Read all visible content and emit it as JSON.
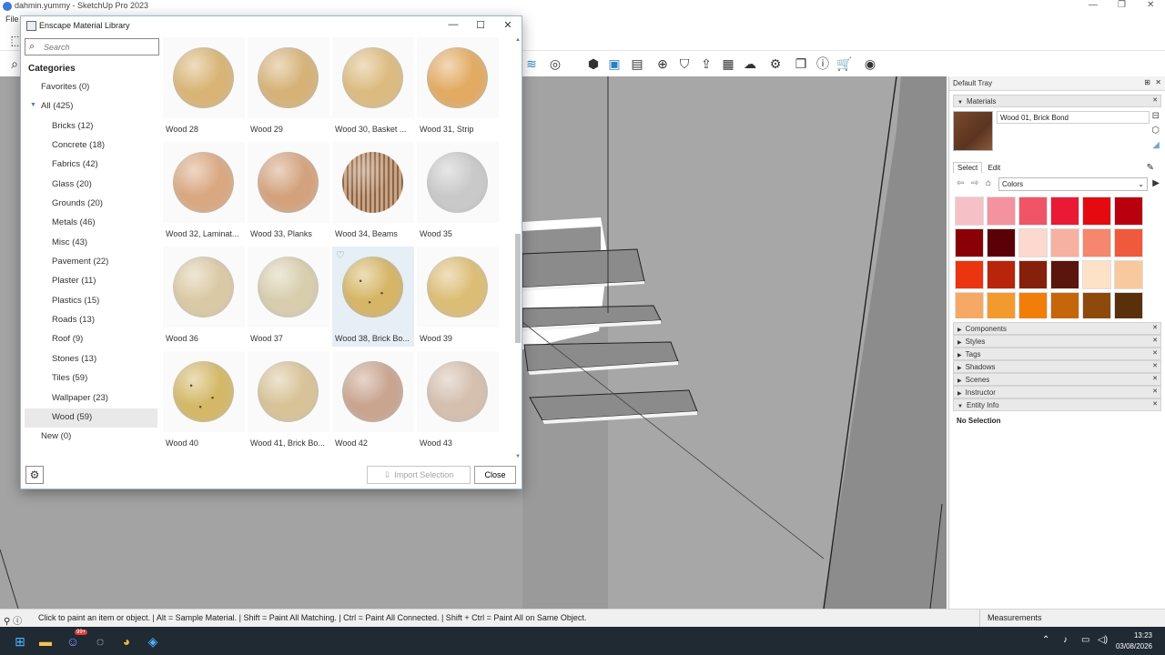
{
  "app": {
    "title": "dahmin.yummy - SketchUp Pro 2023",
    "menu_file": "File"
  },
  "dialog": {
    "title": "Enscape Material Library",
    "search_placeholder": "Search",
    "categories_title": "Categories",
    "categories": [
      {
        "label": "Favorites (0)",
        "level": 0
      },
      {
        "label": "All (425)",
        "level": 0,
        "expanded": true
      },
      {
        "label": "Bricks (12)",
        "level": 1
      },
      {
        "label": "Concrete (18)",
        "level": 1
      },
      {
        "label": "Fabrics (42)",
        "level": 1
      },
      {
        "label": "Glass (20)",
        "level": 1
      },
      {
        "label": "Grounds (20)",
        "level": 1
      },
      {
        "label": "Metals (46)",
        "level": 1
      },
      {
        "label": "Misc (43)",
        "level": 1
      },
      {
        "label": "Pavement (22)",
        "level": 1
      },
      {
        "label": "Plaster (11)",
        "level": 1
      },
      {
        "label": "Plastics (15)",
        "level": 1
      },
      {
        "label": "Roads (13)",
        "level": 1
      },
      {
        "label": "Roof (9)",
        "level": 1
      },
      {
        "label": "Stones (13)",
        "level": 1
      },
      {
        "label": "Tiles (59)",
        "level": 1
      },
      {
        "label": "Wallpaper (23)",
        "level": 1
      },
      {
        "label": "Wood (59)",
        "level": 1,
        "selected": true
      },
      {
        "label": "New (0)",
        "level": 0
      }
    ],
    "materials": [
      {
        "label": "Wood 28",
        "color": "#d9b476"
      },
      {
        "label": "Wood 29",
        "color": "#d6b278"
      },
      {
        "label": "Wood 30, Basket ...",
        "color": "#dcbb80"
      },
      {
        "label": "Wood 31, Strip",
        "color": "#e2aa62"
      },
      {
        "label": "Wood 32, Laminat...",
        "color": "#d9a881"
      },
      {
        "label": "Wood 33, Planks",
        "color": "#d3a27d"
      },
      {
        "label": "Wood 34, Beams",
        "color": "#a9866a",
        "striped": true
      },
      {
        "label": "Wood 35",
        "color": "#c9c9c9"
      },
      {
        "label": "Wood 36",
        "color": "#dac9a5"
      },
      {
        "label": "Wood 37",
        "color": "#d8ceae"
      },
      {
        "label": "Wood 38, Brick Bo...",
        "color": "#d6b666",
        "hovered": true,
        "speckled": true
      },
      {
        "label": "Wood 39",
        "color": "#dcbd75"
      },
      {
        "label": "Wood 40",
        "color": "#d4b868",
        "speckled": true
      },
      {
        "label": "Wood 41, Brick Bo...",
        "color": "#d8c398"
      },
      {
        "label": "Wood 42",
        "color": "#c9a48f"
      },
      {
        "label": "Wood 43",
        "color": "#d5bfae"
      }
    ],
    "import_label": "Import Selection",
    "close_label": "Close"
  },
  "tray": {
    "title": "Default Tray",
    "materials_header": "Materials",
    "current_material": "Wood 01, Brick Bond",
    "tab_select": "Select",
    "tab_edit": "Edit",
    "library": "Colors",
    "swatches": [
      "#f6c0c7",
      "#f592a0",
      "#ef5566",
      "#ea1a35",
      "#e50a0f",
      "#b9000f",
      "#8a0007",
      "#5c0008",
      "#fcd8cf",
      "#f7b1a1",
      "#f4876d",
      "#ee5a3b",
      "#ea3510",
      "#b8250a",
      "#86200c",
      "#5a150d",
      "#fde2c8",
      "#f8c99c",
      "#f6a964",
      "#f39a2e",
      "#f17e09",
      "#c5650c",
      "#8e4a0c",
      "#5a300b"
    ],
    "panels": [
      "Components",
      "Styles",
      "Tags",
      "Shadows",
      "Scenes",
      "Instructor",
      "Entity Info"
    ],
    "entity_info": "No Selection"
  },
  "status": {
    "hint": "Click to paint an item or object. | Alt = Sample Material. | Shift = Paint All Matching. | Ctrl = Paint All Connected. | Shift + Ctrl = Paint All on Same Object.",
    "measurements": "Measurements"
  },
  "taskbar": {
    "time": "13:23",
    "date": "03/08/2026",
    "badge": "99+"
  }
}
